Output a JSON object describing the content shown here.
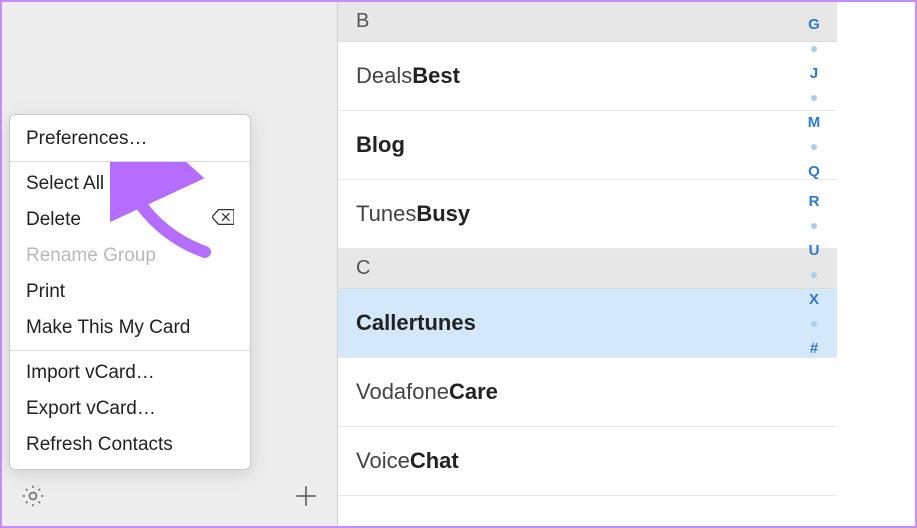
{
  "menu": {
    "preferences": "Preferences…",
    "select_all": "Select All",
    "delete": "Delete",
    "rename_group": "Rename Group",
    "print": "Print",
    "make_my_card": "Make This My Card",
    "import_vcard": "Import vCard…",
    "export_vcard": "Export vCard…",
    "refresh_contacts": "Refresh Contacts"
  },
  "sections": {
    "b": "B",
    "c": "C"
  },
  "contacts": {
    "deals_first": "Deals ",
    "deals_last": "Best",
    "blog": "Blog",
    "tunes_first": "Tunes ",
    "tunes_last": "Busy",
    "callertunes": "Callertunes",
    "care_first": "Vodafone ",
    "care_last": "Care",
    "chat_first": "Voice ",
    "chat_last": "Chat"
  },
  "index": {
    "g": "G",
    "j": "J",
    "m": "M",
    "q": "Q",
    "r": "R",
    "u": "U",
    "x": "X",
    "hash": "#"
  }
}
